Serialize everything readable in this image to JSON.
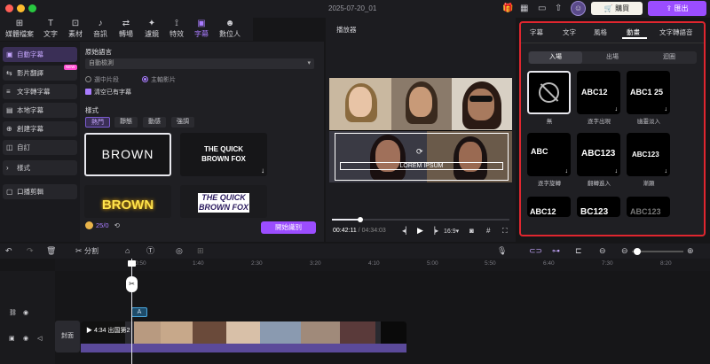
{
  "window": {
    "title": "2025-07-20_01"
  },
  "header": {
    "buy_label": "購買",
    "export_label": "匯出"
  },
  "toolbar": [
    {
      "label": "媒體檔案",
      "icon": "media-icon"
    },
    {
      "label": "文字",
      "icon": "text-icon"
    },
    {
      "label": "素材",
      "icon": "elements-icon"
    },
    {
      "label": "音訊",
      "icon": "audio-icon"
    },
    {
      "label": "轉場",
      "icon": "transition-icon"
    },
    {
      "label": "濾鏡",
      "icon": "filter-icon"
    },
    {
      "label": "特效",
      "icon": "effects-icon"
    },
    {
      "label": "字幕",
      "icon": "caption-icon"
    },
    {
      "label": "數位人",
      "icon": "avatar-icon"
    }
  ],
  "sidebar": {
    "items": [
      {
        "label": "自動字幕"
      },
      {
        "label": "影片翻譯",
        "badge": "NEW"
      },
      {
        "label": "文字轉字幕"
      },
      {
        "label": "本地字幕"
      },
      {
        "label": "創建字幕"
      },
      {
        "label": "自訂"
      },
      {
        "label": "樣式"
      },
      {
        "label": "口播剪輯"
      }
    ]
  },
  "caption": {
    "lang_label": "原始語言",
    "lang_value": "自動檢測",
    "radio_selected_clip": "選中片段",
    "radio_main_video": "主軸影片",
    "clear_label": "清空已有字幕",
    "style_label": "樣式",
    "style_tabs": [
      "熱門",
      "靜態",
      "動感",
      "強調"
    ],
    "tiles": [
      "BROWN",
      "THE QUICK BROWN FOX",
      "BROWN",
      "THE QUICK BROWN FOX"
    ],
    "credits": "25/0",
    "start_label": "開始識別"
  },
  "player": {
    "title": "播放器",
    "caption_text": "LOREM IPSUM",
    "time_current": "00:42:11",
    "time_total": "04:34:03",
    "ratio": "16:9"
  },
  "right": {
    "tabs": [
      "字幕",
      "文字",
      "風格",
      "動畫",
      "文字轉語音"
    ],
    "active_tab": "動畫",
    "subtabs": [
      "入場",
      "出場",
      "迴圈"
    ],
    "animations": [
      {
        "label": "無",
        "text": ""
      },
      {
        "label": "逐字出現",
        "text": "ABC12"
      },
      {
        "label": "幽靈淡入",
        "text": "ABC1 25"
      },
      {
        "label": "逐字旋轉",
        "text": "ABC"
      },
      {
        "label": "翻轉進入",
        "text": "ABC123"
      },
      {
        "label": "漸顯",
        "text": "ABC123"
      },
      {
        "label": "",
        "text": "ABC12"
      },
      {
        "label": "",
        "text": "BC123"
      },
      {
        "label": "",
        "text": "ABC123"
      }
    ]
  },
  "timeline": {
    "split_label": "分割",
    "ticks": [
      "0:50",
      "1:40",
      "2:30",
      "3:20",
      "4:10",
      "5:00",
      "5:50",
      "6:40",
      "7:30",
      "8:20"
    ],
    "clip_title": "4:34 出国第2",
    "track_label": "封面",
    "caption_chip": "A",
    "accent": "#9b4dff"
  }
}
